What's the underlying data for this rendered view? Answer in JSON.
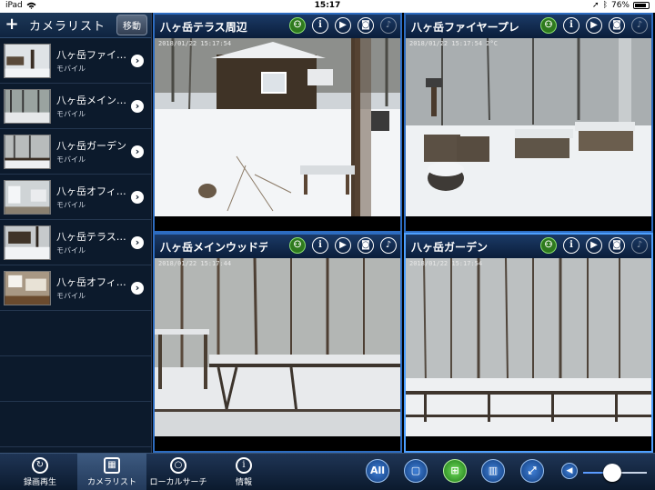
{
  "status": {
    "time": "15:17",
    "battery": "76%",
    "battery_level": 0.76
  },
  "sidebar": {
    "title": "カメラリスト",
    "move_label": "移動",
    "cameras": [
      {
        "name": "八ヶ岳ファイ…",
        "type": "モバイル"
      },
      {
        "name": "八ヶ岳メイン…",
        "type": "モバイル"
      },
      {
        "name": "八ヶ岳ガーデン",
        "type": "モバイル"
      },
      {
        "name": "八ヶ岳オフィ…",
        "type": "モバイル"
      },
      {
        "name": "八ヶ岳テラス…",
        "type": "モバイル"
      },
      {
        "name": "八ヶ岳オフィ…",
        "type": "モバイル"
      }
    ]
  },
  "tiles": [
    {
      "title": "八ヶ岳テラス周辺",
      "stamp": "2018/01/22 15:17:54"
    },
    {
      "title": "八ヶ岳ファイヤープレ…",
      "stamp": "2018/01/22 15:17:54 2°C"
    },
    {
      "title": "八ヶ岳メインウッドデ…",
      "stamp": "2018/01/22 15:17:44"
    },
    {
      "title": "八ヶ岳ガーデン",
      "stamp": "2018/01/22 15:17:54"
    }
  ],
  "toolbar": {
    "tabs": [
      {
        "label": "録画再生",
        "icon": "playback-icon"
      },
      {
        "label": "カメラリスト",
        "icon": "camera-list-icon"
      },
      {
        "label": "ローカルサーチ",
        "icon": "search-icon"
      },
      {
        "label": "情報",
        "icon": "info-icon"
      }
    ],
    "all_label": "All",
    "volume_level": 0.45
  }
}
